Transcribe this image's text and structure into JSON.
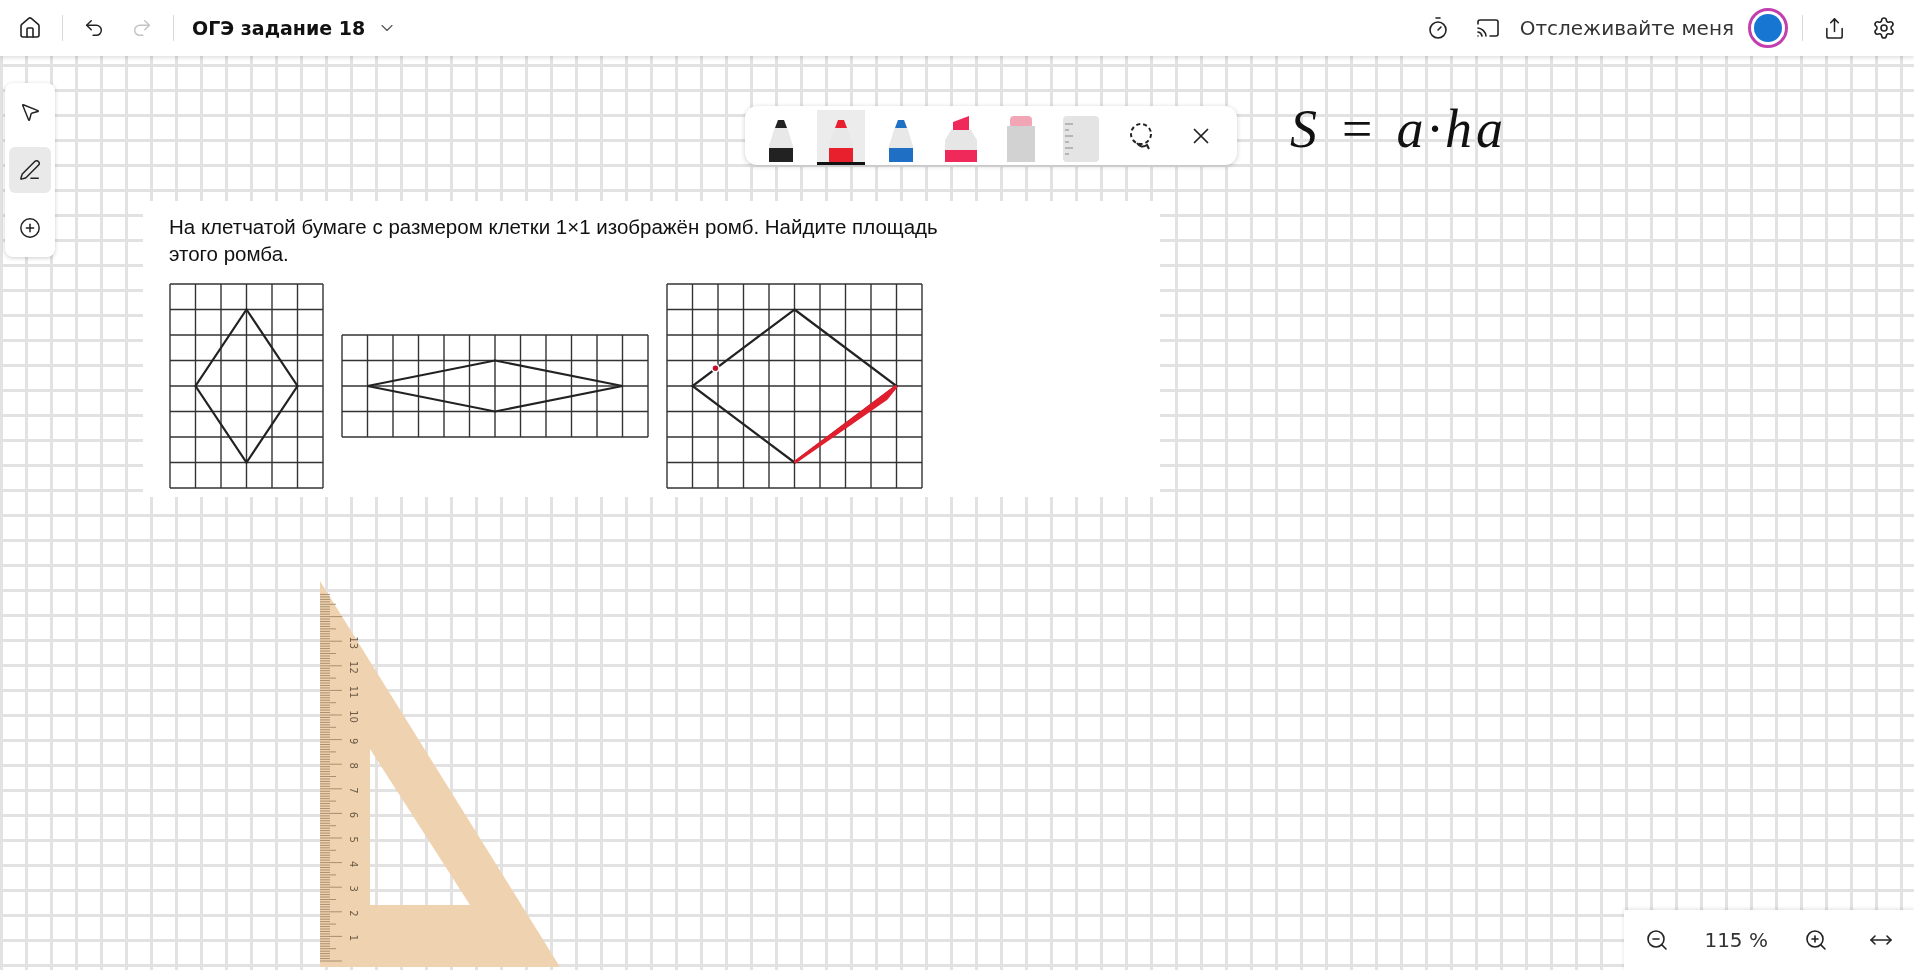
{
  "topbar": {
    "title": "ОГЭ задание 18",
    "undo_disabled": false,
    "redo_disabled": true,
    "tracking_label": "Отслеживайте меня"
  },
  "left_tools": [
    {
      "kind": "select",
      "selected": false
    },
    {
      "kind": "pen",
      "selected": true
    },
    {
      "kind": "add",
      "selected": false
    }
  ],
  "pen_toolbar": [
    {
      "kind": "pen",
      "color": "#222222",
      "selected": false
    },
    {
      "kind": "pen",
      "color": "#e8202e",
      "selected": true
    },
    {
      "kind": "pen",
      "color": "#1f6fc4",
      "selected": false
    },
    {
      "kind": "highlighter",
      "color": "#ef2a5a",
      "selected": false
    },
    {
      "kind": "eraser",
      "color": "#f2a5b4",
      "selected": false
    },
    {
      "kind": "ruler",
      "selected": false
    },
    {
      "kind": "lasso",
      "selected": false
    },
    {
      "kind": "close",
      "selected": false
    }
  ],
  "question": {
    "text": "На клетчатой бумаге с размером клетки 1×1 изображён ромб. Найдите площадь этого ромба."
  },
  "handwriting": {
    "text": "S = a·ha"
  },
  "set_square": {
    "marks": [
      "1",
      "2",
      "3",
      "4",
      "5",
      "6",
      "7",
      "8",
      "9",
      "10",
      "11",
      "12",
      "13"
    ]
  },
  "zoom_bar": {
    "zoom_text": "115 %"
  }
}
